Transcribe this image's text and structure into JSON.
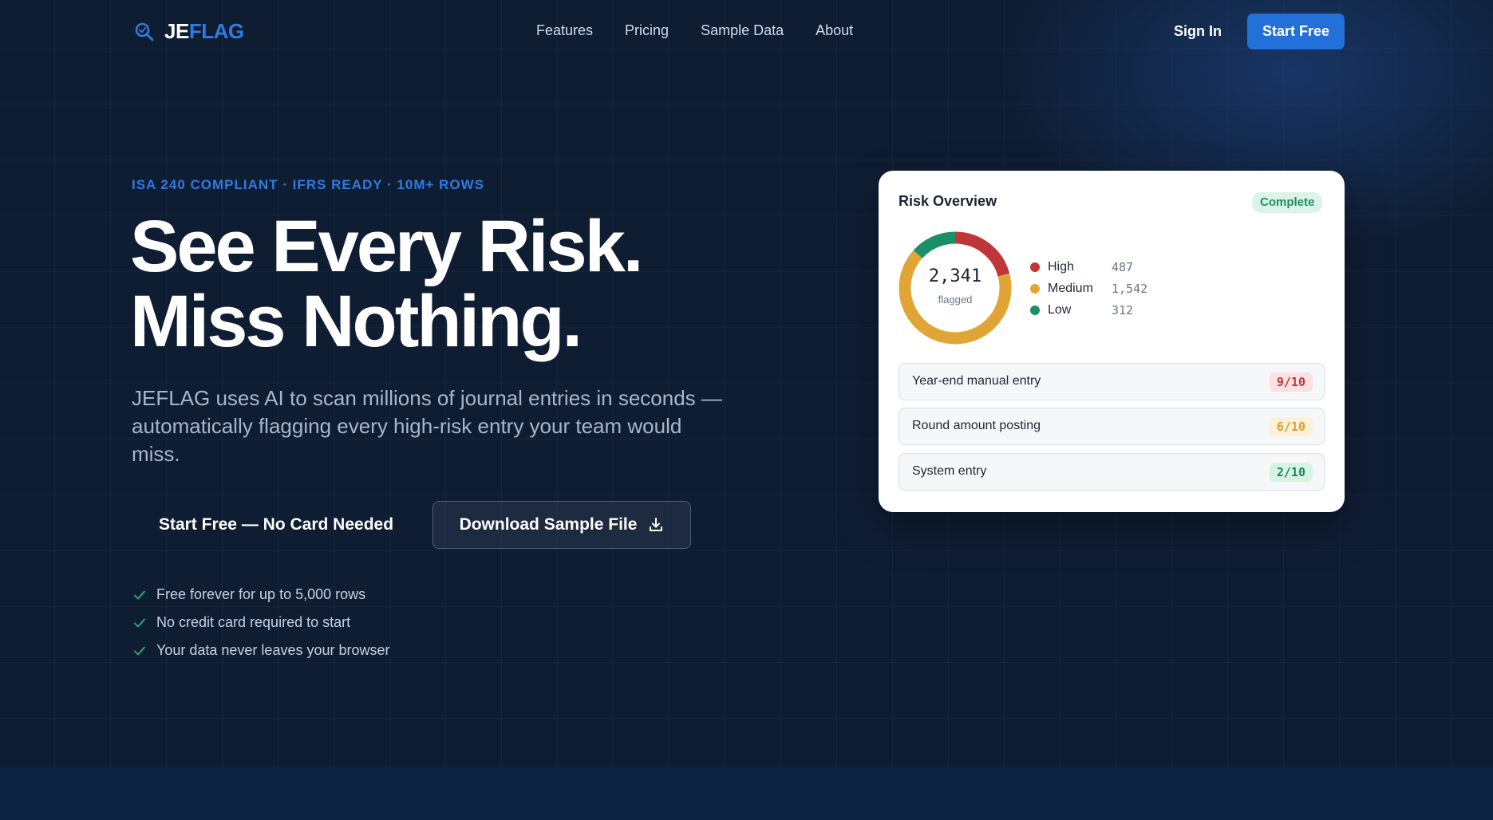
{
  "brand": {
    "logo_prefix": "JE",
    "logo_suffix": "FLAG",
    "accent_color": "#2f7be0"
  },
  "nav": {
    "links": [
      "Features",
      "Pricing",
      "Sample Data",
      "About"
    ],
    "sign_in": "Sign In",
    "start_free": "Start Free"
  },
  "hero": {
    "eyebrow": "ISA 240 COMPLIANT · IFRS READY · 10M+ ROWS",
    "headline_line1": "See Every Risk.",
    "headline_line2": "Miss Nothing.",
    "subtext": "JEFLAG uses AI to scan millions of journal entries in seconds — automatically flagging every high-risk entry your team would miss.",
    "cta_primary": "Start Free — No Card Needed",
    "cta_secondary": "Download Sample File",
    "checklist": [
      "Free forever for up to 5,000 rows",
      "No credit card required to start",
      "Your data never leaves your browser"
    ]
  },
  "risk_card": {
    "title": "Risk Overview",
    "status": "Complete",
    "total_flagged": "2,341",
    "total_label": "flagged",
    "legend": [
      {
        "name": "High",
        "value": "487",
        "color": "#c0353a"
      },
      {
        "name": "Medium",
        "value": "1,542",
        "color": "#e0a535"
      },
      {
        "name": "Low",
        "value": "312",
        "color": "#1a9068"
      }
    ],
    "entries": [
      {
        "label": "Year-end manual entry",
        "score": "9/10",
        "level": "high"
      },
      {
        "label": "Round amount posting",
        "score": "6/10",
        "level": "med"
      },
      {
        "label": "System entry",
        "score": "2/10",
        "level": "low"
      }
    ]
  }
}
